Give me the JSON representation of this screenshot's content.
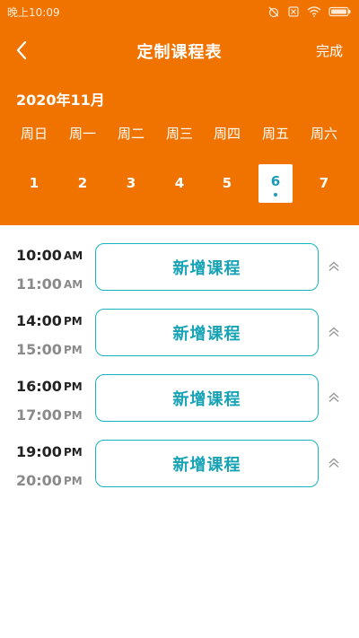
{
  "status_bar": {
    "time": "晚上10:09"
  },
  "nav": {
    "title": "定制课程表",
    "done_label": "完成",
    "back_icon": "chevron-left-icon"
  },
  "calendar": {
    "month_label": "2020年11月",
    "weekdays": [
      "周日",
      "周一",
      "周二",
      "周三",
      "周四",
      "周五",
      "周六"
    ],
    "dates": [
      "1",
      "2",
      "3",
      "4",
      "5",
      "6",
      "7"
    ],
    "selected_date": "6"
  },
  "schedule": {
    "slots": [
      {
        "start_time": "10:00",
        "start_period": "AM",
        "end_time": "11:00",
        "end_period": "AM",
        "button_label": "新增课程"
      },
      {
        "start_time": "14:00",
        "start_period": "PM",
        "end_time": "15:00",
        "end_period": "PM",
        "button_label": "新增课程"
      },
      {
        "start_time": "16:00",
        "start_period": "PM",
        "end_time": "17:00",
        "end_period": "PM",
        "button_label": "新增课程"
      },
      {
        "start_time": "19:00",
        "start_period": "PM",
        "end_time": "20:00",
        "end_period": "PM",
        "button_label": "新增课程"
      }
    ]
  },
  "colors": {
    "header_bg": "#f07300",
    "accent_teal": "#16a3b5"
  }
}
